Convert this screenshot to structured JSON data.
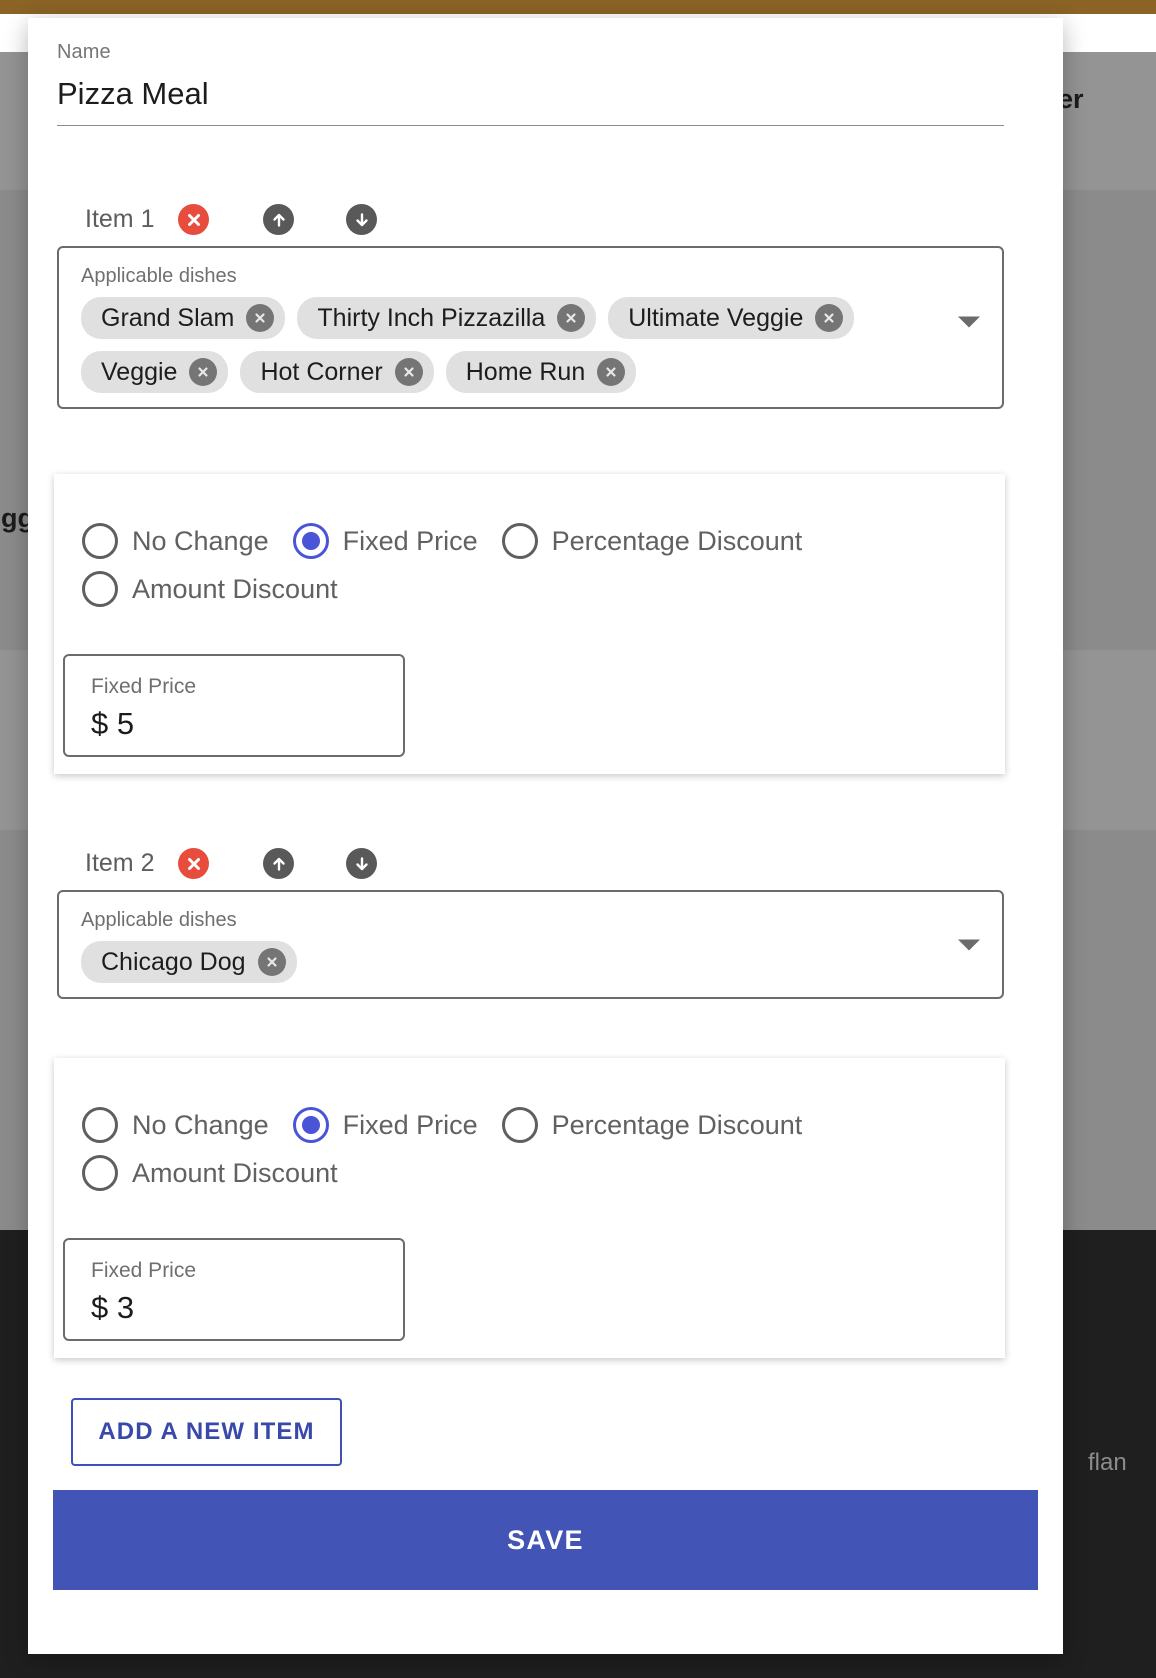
{
  "background": {
    "right_text_fragment": "er",
    "left_text_fragment": "egg",
    "footer_text_fragment": "flan",
    "topbar_color": "#8a6325",
    "footer_color": "#1f1f1f"
  },
  "modal": {
    "name_field": {
      "label": "Name",
      "value": "Pizza Meal"
    },
    "items": [
      {
        "header_label": "Item 1",
        "delete_icon": "delete-circle-icon",
        "move_up_icon": "arrow-up-circle-icon",
        "move_down_icon": "arrow-down-circle-icon",
        "dishes": {
          "label": "Applicable dishes",
          "chips": [
            "Grand Slam",
            "Thirty Inch Pizzazilla",
            "Ultimate Veggie",
            "Veggie",
            "Hot Corner",
            "Home Run"
          ],
          "dropdown_icon": "chevron-down-icon"
        },
        "pricing": {
          "options": [
            "No Change",
            "Fixed Price",
            "Percentage Discount",
            "Amount Discount"
          ],
          "selected": "Fixed Price",
          "input": {
            "label": "Fixed Price",
            "value": "$ 5"
          }
        }
      },
      {
        "header_label": "Item 2",
        "delete_icon": "delete-circle-icon",
        "move_up_icon": "arrow-up-circle-icon",
        "move_down_icon": "arrow-down-circle-icon",
        "dishes": {
          "label": "Applicable dishes",
          "chips": [
            "Chicago Dog"
          ],
          "dropdown_icon": "chevron-down-icon"
        },
        "pricing": {
          "options": [
            "No Change",
            "Fixed Price",
            "Percentage Discount",
            "Amount Discount"
          ],
          "selected": "Fixed Price",
          "input": {
            "label": "Fixed Price",
            "value": "$ 3"
          }
        }
      }
    ],
    "add_item_label": "ADD A NEW ITEM",
    "save_label": "SAVE",
    "accent_color": "#4254b5",
    "delete_color": "#e74c3c"
  }
}
